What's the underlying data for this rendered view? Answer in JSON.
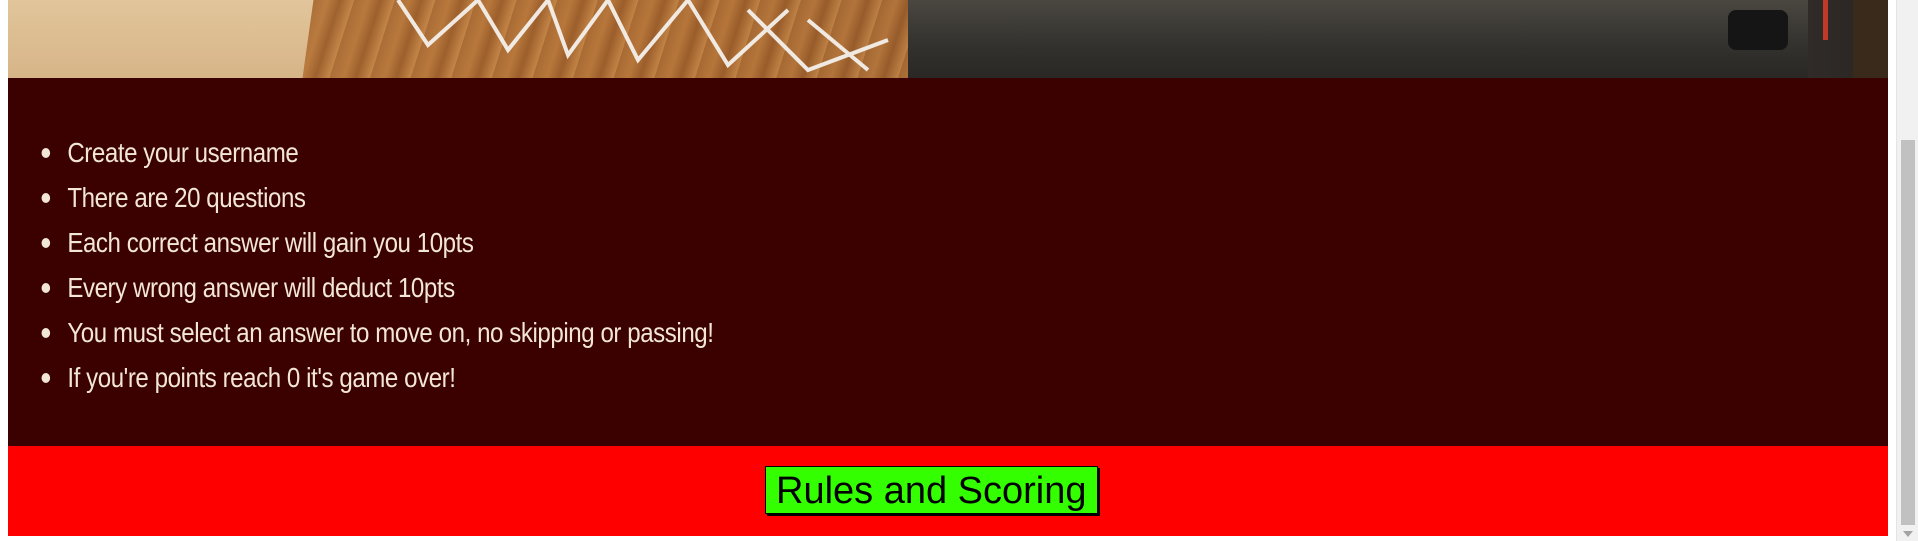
{
  "rules": {
    "items": [
      "Create your username",
      "There are 20 questions",
      "Each correct answer will gain you 10pts",
      "Every wrong answer will deduct 10pts",
      "You must select an answer to move on, no skipping or passing!",
      "If you're points reach 0 it's game over!"
    ]
  },
  "footer": {
    "button_label": "Rules and Scoring"
  },
  "colors": {
    "rules_background": "#3b0000",
    "rules_text": "#f2e6d6",
    "footer_background": "#ff0000",
    "button_background": "#33ff00"
  },
  "icons": {
    "bullet": "disc-bullet-icon",
    "scroll_down": "scroll-down-arrow-icon"
  }
}
